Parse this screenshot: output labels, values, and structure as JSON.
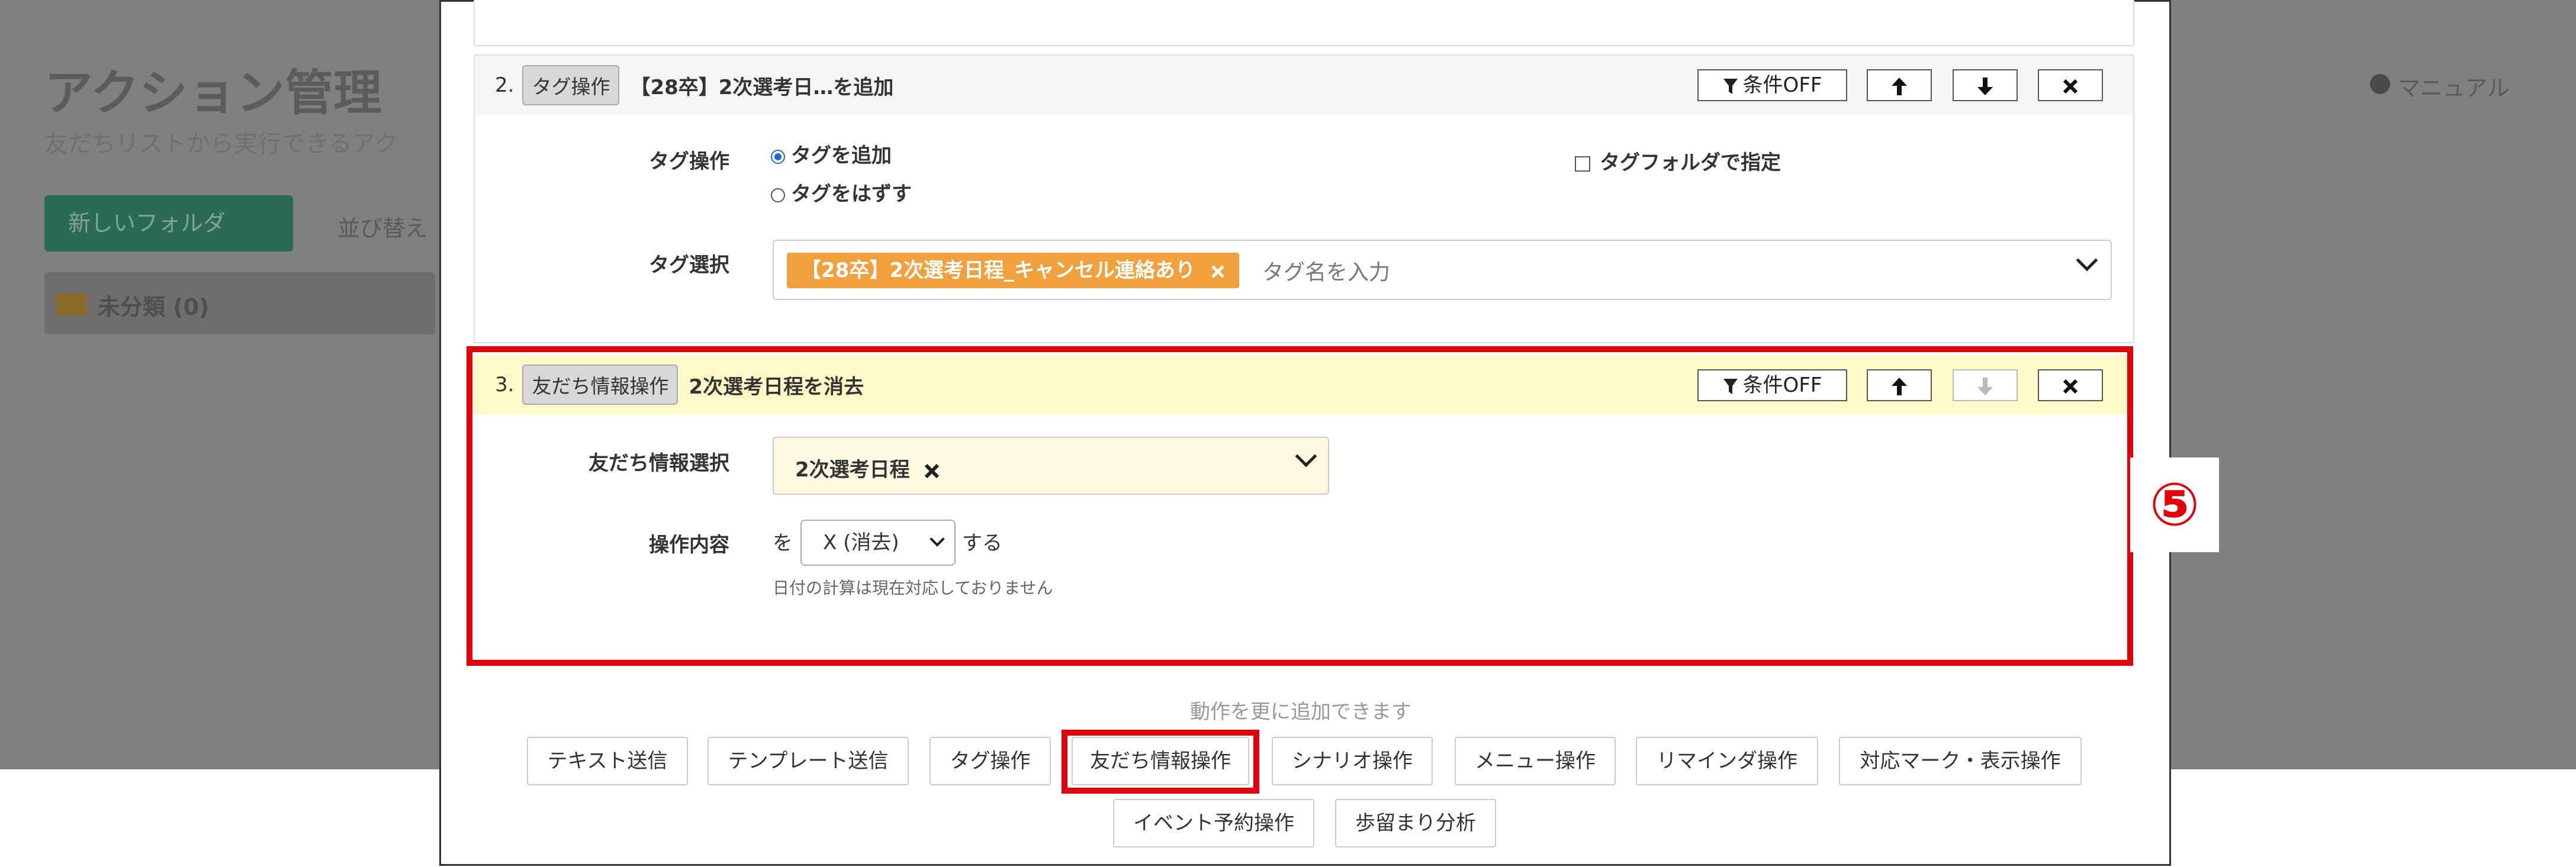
{
  "background": {
    "title": "アクション管理",
    "subtitle": "友だちリストから実行できるアク",
    "new_folder_button": "新しいフォルダ",
    "sort_label": "並び替え",
    "folder_label": "未分類 (0)",
    "manual_link": "マニュアル"
  },
  "action2": {
    "number": "2.",
    "type": "タグ操作",
    "title": "【28卒】2次選考日…を追加",
    "cond_label": "条件OFF",
    "tag_op_label": "タグ操作",
    "radio_add": "タグを追加",
    "radio_remove": "タグをはずす",
    "folder_checkbox": "タグフォルダで指定",
    "tag_select_label": "タグ選択",
    "selected_tag": "【28卒】2次選考日程_キャンセル連絡あり",
    "tag_input_placeholder": "タグ名を入力"
  },
  "action3": {
    "number": "3.",
    "type": "友だち情報操作",
    "title": "2次選考日程を消去",
    "cond_label": "条件OFF",
    "friend_info_label": "友だち情報選択",
    "friend_info_value": "2次選考日程",
    "operation_label": "操作内容",
    "prefix": "を",
    "operation_value": "X (消去)",
    "suffix": "する",
    "note": "日付の計算は現在対応しておりません"
  },
  "add_more_caption": "動作を更に追加できます",
  "add_buttons": [
    "テキスト送信",
    "テンプレート送信",
    "タグ操作",
    "友だち情報操作",
    "シナリオ操作",
    "メニュー操作",
    "リマインダ操作",
    "対応マーク・表示操作",
    "イベント予約操作",
    "歩留まり分析"
  ],
  "annotation_marker": "⑤",
  "icons": {
    "filter": "filter-icon",
    "up": "arrow-up-icon",
    "down": "arrow-down-icon",
    "remove": "close-icon",
    "dropdown": "chevron-down-icon"
  },
  "colors": {
    "highlight_red": "#e3000b",
    "tag_chip": "#f0a03c",
    "action3_header_bg": "#fff9c8",
    "action2_header_bg": "#f5f5f5"
  }
}
